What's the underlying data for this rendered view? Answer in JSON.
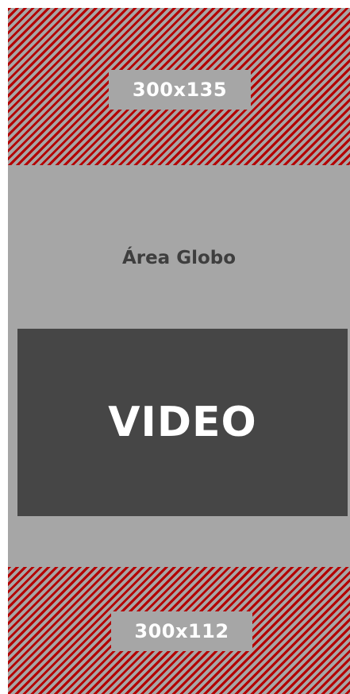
{
  "ad_top": {
    "label": "300x135"
  },
  "area": {
    "title": "Área Globo"
  },
  "video": {
    "label": "VIDEO"
  },
  "ad_bottom": {
    "label": "300x112"
  },
  "colors": {
    "background": "#a6a6a6",
    "stripe": "#b40000",
    "video_bg": "#464646",
    "title_text": "#3e3e3e",
    "label_text": "#ffffff"
  }
}
